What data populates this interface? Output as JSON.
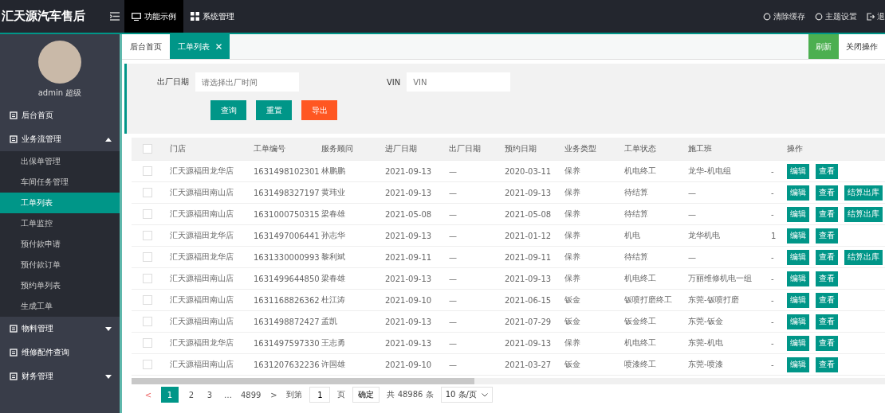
{
  "header": {
    "logo": "汇天源汽车售后",
    "nav": [
      {
        "label": "功能示例",
        "selected": true
      },
      {
        "label": "系统管理",
        "selected": false
      }
    ],
    "actions": [
      {
        "label": "清除缓存"
      },
      {
        "label": "主题设置"
      },
      {
        "label": "退"
      }
    ]
  },
  "sidebar": {
    "user_name": "admin 超级",
    "items": [
      {
        "label": "后台首页",
        "selected": false
      },
      {
        "label": "业务流管理",
        "selected": false,
        "expanded": true,
        "children": [
          {
            "label": "出保单管理",
            "selected": false
          },
          {
            "label": "车间任务管理",
            "selected": false
          },
          {
            "label": "工单列表",
            "selected": true
          },
          {
            "label": "工单监控",
            "selected": false
          },
          {
            "label": "预付款申请",
            "selected": false
          },
          {
            "label": "预付款订单",
            "selected": false
          },
          {
            "label": "预约单列表",
            "selected": false
          },
          {
            "label": "生成工单",
            "selected": false
          }
        ]
      },
      {
        "label": "物料管理",
        "selected": false,
        "expanded": false
      },
      {
        "label": "维修配件查询",
        "selected": false
      },
      {
        "label": "财务管理",
        "selected": false,
        "expanded": false
      }
    ]
  },
  "tabs": [
    {
      "label": "后台首页",
      "selected": false,
      "closable": false
    },
    {
      "label": "工单列表",
      "selected": true,
      "closable": true
    }
  ],
  "tab_actions": [
    {
      "label": "刷新",
      "kind": "primary"
    },
    {
      "label": "关闭操作",
      "kind": "plain"
    }
  ],
  "search": {
    "fields": [
      {
        "label": "出厂日期",
        "placeholder": "请选择出厂时间"
      },
      {
        "label": "VIN",
        "placeholder": "VIN"
      }
    ],
    "buttons": [
      {
        "label": "查询",
        "kind": "primary"
      },
      {
        "label": "重置",
        "kind": "primary"
      },
      {
        "label": "导出",
        "kind": "danger"
      }
    ]
  },
  "table": {
    "header_checked": false,
    "columns": [
      "门店",
      "工单编号",
      "服务顾问",
      "进厂日期",
      "出厂日期",
      "预约日期",
      "业务类型",
      "工单状态",
      "施工班",
      "",
      "操作"
    ],
    "rows": [
      {
        "checked": false,
        "cells": [
          "汇天源福田龙华店",
          "1631498102301",
          "林鹏鹏",
          "2021-09-13",
          "—",
          "2020-03-11",
          "保养",
          "机电终工",
          "龙华-机电组",
          "-"
        ],
        "actions": [
          "编辑",
          "查看"
        ]
      },
      {
        "checked": false,
        "cells": [
          "汇天源福田南山店",
          "1631498327197",
          "黄玮业",
          "2021-09-13",
          "—",
          "2021-09-13",
          "保养",
          "待结算",
          "—",
          "-"
        ],
        "actions": [
          "编辑",
          "查看",
          "结算出库"
        ]
      },
      {
        "checked": false,
        "cells": [
          "汇天源福田南山店",
          "1631000750315",
          "梁春雄",
          "2021-05-08",
          "—",
          "2021-05-08",
          "保养",
          "待结算",
          "—",
          "-"
        ],
        "actions": [
          "编辑",
          "查看",
          "结算出库"
        ]
      },
      {
        "checked": false,
        "cells": [
          "汇天源福田龙华店",
          "1631497006441",
          "孙志华",
          "2021-09-13",
          "—",
          "2021-01-12",
          "保养",
          "机电",
          "龙华机电",
          "1"
        ],
        "actions": [
          "编辑",
          "查看"
        ]
      },
      {
        "checked": false,
        "cells": [
          "汇天源福田龙华店",
          "1631330000993",
          "黎利斌",
          "2021-09-11",
          "—",
          "2021-09-11",
          "保养",
          "待结算",
          "—",
          "-"
        ],
        "actions": [
          "编辑",
          "查看",
          "结算出库"
        ]
      },
      {
        "checked": false,
        "cells": [
          "汇天源福田南山店",
          "1631499644850",
          "梁春雄",
          "2021-09-13",
          "—",
          "2021-09-13",
          "保养",
          "机电终工",
          "万丽维修机电一组",
          "-"
        ],
        "actions": [
          "编辑",
          "查看"
        ]
      },
      {
        "checked": false,
        "cells": [
          "汇天源福田南山店",
          "1631168826362",
          "杜江涛",
          "2021-09-10",
          "—",
          "2021-06-15",
          "钣金",
          "钣喷打磨终工",
          "东莞-钣喷打磨",
          "-"
        ],
        "actions": [
          "编辑",
          "查看"
        ]
      },
      {
        "checked": false,
        "cells": [
          "汇天源福田南山店",
          "1631498872427",
          "孟凯",
          "2021-09-13",
          "—",
          "2021-07-29",
          "钣金",
          "钣金终工",
          "东莞-钣金",
          "-"
        ],
        "actions": [
          "编辑",
          "查看"
        ]
      },
      {
        "checked": false,
        "cells": [
          "汇天源福田龙华店",
          "1631497597330",
          "王志勇",
          "2021-09-13",
          "—",
          "2021-09-13",
          "保养",
          "机电终工",
          "东莞-机电",
          "-"
        ],
        "actions": [
          "编辑",
          "查看"
        ]
      },
      {
        "checked": false,
        "cells": [
          "汇天源福田南山店",
          "1631207632236",
          "许国雄",
          "2021-09-10",
          "—",
          "2021-03-27",
          "钣金",
          "喷漆终工",
          "东莞-喷漆",
          "-"
        ],
        "actions": [
          "编辑",
          "查看"
        ]
      }
    ]
  },
  "pagination": {
    "prev": "<",
    "pages": [
      {
        "label": "1",
        "selected": true
      },
      {
        "label": "2",
        "selected": false
      },
      {
        "label": "3",
        "selected": false
      },
      {
        "label": "…",
        "selected": false
      },
      {
        "label": "4899",
        "selected": false
      }
    ],
    "next": ">",
    "goto_label": "到第",
    "goto_value": "1",
    "page_unit": "页",
    "confirm": "确定",
    "total": "共 48986 条",
    "page_size": "10 条/页"
  }
}
